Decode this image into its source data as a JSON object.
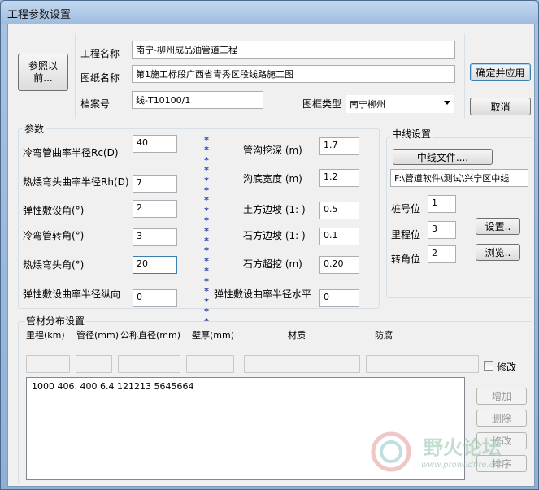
{
  "window": {
    "title": "工程参数设置"
  },
  "header": {
    "refer_button": "参照以前...",
    "project_name_label": "工程名称",
    "project_name_value": "南宁-柳州成品油管道工程",
    "drawing_name_label": "图纸名称",
    "drawing_name_value": "第1施工标段广西省青秀区段线路施工图",
    "archive_label": "档案号",
    "archive_value": "线-T10100/1",
    "frame_type_label": "图框类型",
    "frame_type_value": "南宁柳州",
    "confirm_button": "确定并应用",
    "cancel_button": "取消"
  },
  "params": {
    "group_label": "参数",
    "left": [
      {
        "label": "冷弯管曲率半径Rc(D)",
        "value": "40"
      },
      {
        "label": "热煨弯头曲率半径Rh(D)",
        "value": "7"
      },
      {
        "label": "弹性敷设角(°)",
        "value": "2"
      },
      {
        "label": "冷弯管转角(°)",
        "value": "3"
      },
      {
        "label": "热煨弯头角(°)",
        "value": "20"
      },
      {
        "label": "弹性敷设曲率半径纵向",
        "value": "0"
      }
    ],
    "right": [
      {
        "label": "管沟挖深  (m)",
        "value": "1.7"
      },
      {
        "label": "沟底宽度  (m)",
        "value": "1.2"
      },
      {
        "label": "土方边坡 (1: )",
        "value": "0.5"
      },
      {
        "label": "石方边坡 (1: )",
        "value": "0.1"
      },
      {
        "label": "石方超挖  (m)",
        "value": "0.20"
      },
      {
        "label": "弹性敷设曲率半径水平",
        "value": "0"
      }
    ],
    "separator": "*\n*\n*\n*\n*\n*\n*\n*\n*\n*\n*\n*\n*\n*\n*\n*\n*\n*\n*"
  },
  "centerline": {
    "group_label": "中线设置",
    "file_button": "中线文件....",
    "path_value": "F:\\管道软件\\测试\\兴宁区中线",
    "stake_label": "桩号位",
    "stake_value": "1",
    "mileage_label": "里程位",
    "mileage_value": "3",
    "turn_label": "转角位",
    "turn_value": "2",
    "settings_button": "设置..",
    "browse_button": "浏览.."
  },
  "pipe": {
    "group_label": "管材分布设置",
    "columns": [
      "里程(km)",
      "管径(mm)",
      "公称直径(mm)",
      "壁厚(mm)",
      "材质",
      "防腐"
    ],
    "modify_checkbox": "修改",
    "list_text": "1000 406. 400 6.4 121213 5645664",
    "add_button": "增加",
    "delete_button": "删除",
    "modify_button": "修改",
    "sort_button": "排序"
  },
  "watermark": {
    "text_cn": "野火论坛",
    "text_url": "www.prowildfire.cn"
  }
}
